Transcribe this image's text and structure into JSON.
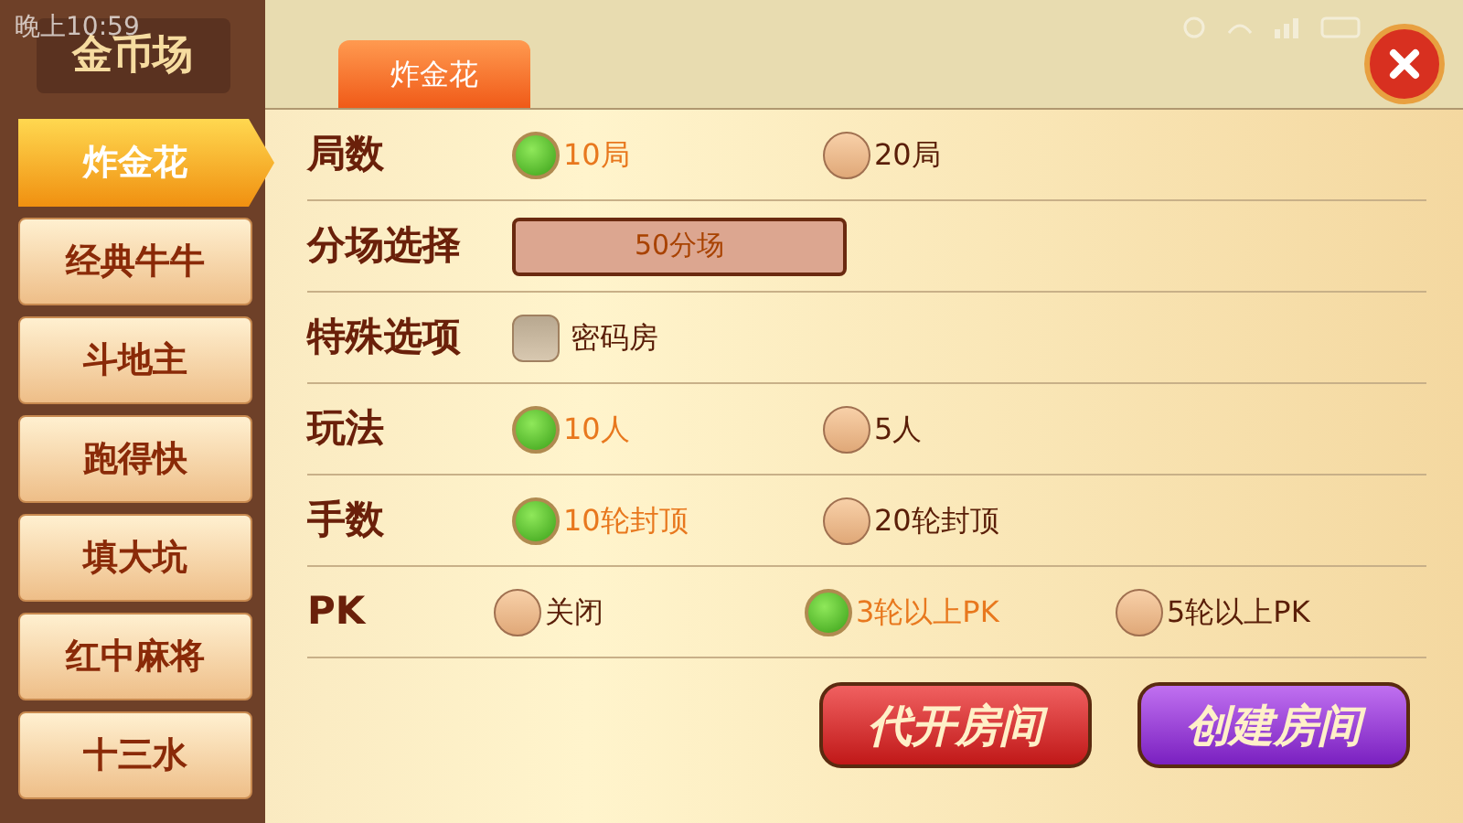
{
  "status_bar": {
    "time": "晚上10:59"
  },
  "sidebar": {
    "title": "金币场",
    "items": [
      {
        "label": "炸金花",
        "selected": true
      },
      {
        "label": "经典牛牛",
        "selected": false
      },
      {
        "label": "斗地主",
        "selected": false
      },
      {
        "label": "跑得快",
        "selected": false
      },
      {
        "label": "填大坑",
        "selected": false
      },
      {
        "label": "红中麻将",
        "selected": false
      },
      {
        "label": "十三水",
        "selected": false
      }
    ]
  },
  "tabs": [
    {
      "label": "炸金花",
      "selected": true
    }
  ],
  "rows": [
    {
      "label": "局数",
      "kind": "radio",
      "options": [
        {
          "label": "10局",
          "selected": true
        },
        {
          "label": "20局",
          "selected": false
        }
      ]
    },
    {
      "label": "分场选择",
      "kind": "select",
      "value": "50分场"
    },
    {
      "label": "特殊选项",
      "kind": "checkbox",
      "options": [
        {
          "label": "密码房",
          "checked": false
        }
      ]
    },
    {
      "label": "玩法",
      "kind": "radio",
      "options": [
        {
          "label": "10人",
          "selected": true
        },
        {
          "label": "5人",
          "selected": false
        }
      ]
    },
    {
      "label": "手数",
      "kind": "radio",
      "options": [
        {
          "label": "10轮封顶",
          "selected": true
        },
        {
          "label": "20轮封顶",
          "selected": false
        }
      ]
    },
    {
      "label": "PK",
      "kind": "radio",
      "options": [
        {
          "label": "关闭",
          "selected": false
        },
        {
          "label": "3轮以上PK",
          "selected": true
        },
        {
          "label": "5轮以上PK",
          "selected": false
        }
      ]
    }
  ],
  "buttons": [
    {
      "label": "代开房间",
      "kind": "red"
    },
    {
      "label": "创建房间",
      "kind": "purple"
    }
  ]
}
